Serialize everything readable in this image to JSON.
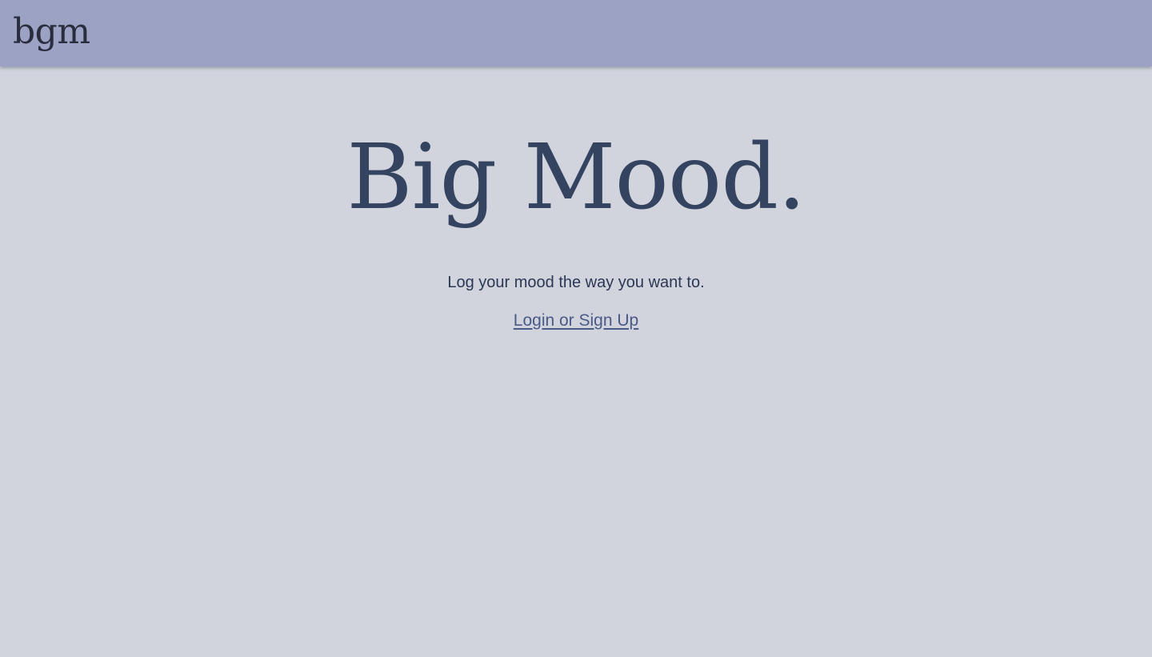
{
  "header": {
    "brand": "bgm"
  },
  "hero": {
    "title": "Big Mood.",
    "tagline": "Log your mood the way you want to.",
    "cta_label": "Login or Sign Up"
  },
  "colors": {
    "header_bg": "#9ca2c4",
    "page_bg": "#d1d4dd",
    "title": "#34435f",
    "link": "#4a5a86"
  }
}
